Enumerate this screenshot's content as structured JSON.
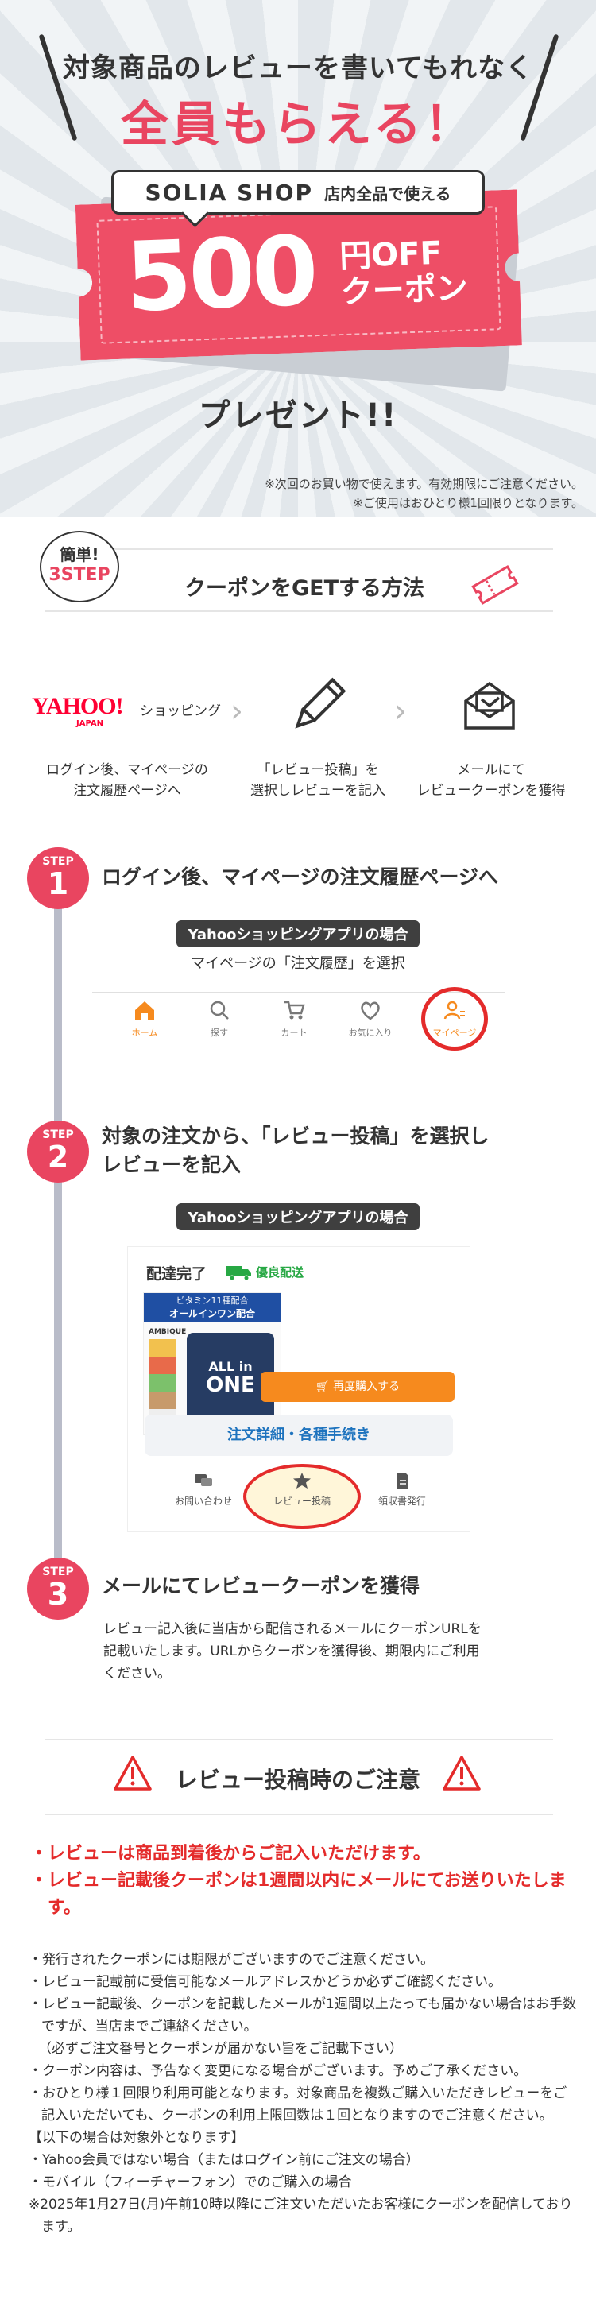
{
  "hero": {
    "line1": "対象商品のレビューを書いてもれなく",
    "line2": "全員もらえる！",
    "shop_logo": "SOLIA SHOP",
    "shop_subtitle": "店内全品で使える",
    "coupon_amount": "500",
    "coupon_unit_off": "円OFF",
    "coupon_type": "クーポン",
    "present": "プレゼント!!",
    "note1": "※次回のお買い物で使えます。有効期限にご注意ください。",
    "note2": "※ご使用はおひとり様1回限りとなります。"
  },
  "howto": {
    "badge_line1": "簡単!",
    "badge_line2": "3STEP",
    "title": "クーポンをGETする方法",
    "yahoo_logo": "YAHOO!",
    "yahoo_japan": "JAPAN",
    "yahoo_shopping": "ショッピング",
    "flow": [
      {
        "label1": "ログイン後、マイページの",
        "label2": "注文履歴ページへ"
      },
      {
        "label1": "「レビュー投稿」を",
        "label2": "選択しレビューを記入"
      },
      {
        "label1": "メールにて",
        "label2": "レビュークーポンを獲得"
      }
    ]
  },
  "steps": [
    {
      "word": "STEP",
      "num": "1",
      "title": "ログイン後、マイページの注文履歴ページへ",
      "app_label": "Yahooショッピングアプリの場合",
      "sub": "マイページの「注文履歴」を選択",
      "nav": [
        "ホーム",
        "探す",
        "カート",
        "お気に入り",
        "マイページ"
      ]
    },
    {
      "word": "STEP",
      "num": "2",
      "title_line1": "対象の注文から、「レビュー投稿」を選択し",
      "title_line2": "レビューを記入",
      "app_label": "Yahooショッピングアプリの場合",
      "delivered": "配達完了",
      "yuryo": "優良配送",
      "product_banner1": "ビタミン11種配合",
      "product_banner2": "オールインワン配合",
      "product_brand": "AMBIQUE",
      "product_name1": "ALL in",
      "product_name2": "ONE",
      "rebuy": "再度購入する",
      "detail": "注文詳細・各種手続き",
      "actions": [
        "お問い合わせ",
        "レビュー投稿",
        "領収書発行"
      ]
    },
    {
      "word": "STEP",
      "num": "3",
      "title": "メールにてレビュークーポンを獲得",
      "body1": "レビュー記入後に当店から配信されるメールにクーポンURLを",
      "body2": "記載いたします。URLからクーポンを獲得後、期限内にご利用",
      "body3": "ください。"
    }
  ],
  "notice": {
    "title": "レビュー投稿時のご注意",
    "red1": "・レビューは商品到着後からご記入いただけます。",
    "red2": "・レビュー記載後クーポンは1週間以内にメールにてお送りいたします。",
    "lines": [
      "・発行されたクーポンには期限がございますのでご注意ください。",
      "・レビュー記載前に受信可能なメールアドレスかどうか必ずご確認ください。",
      "・レビュー記載後、クーポンを記載したメールが1週間以上たっても届かない場合はお手数ですが、当店までご連絡ください。",
      "（必ずご注文番号とクーポンが届かない旨をご記載下さい）",
      "・クーポン内容は、予告なく変更になる場合がございます。予めご了承ください。",
      "・おひとり様１回限り利用可能となります。対象商品を複数ご購入いただきレビューをご記入いただいても、クーポンの利用上限回数は１回となりますのでご注意ください。",
      "【以下の場合は対象外となります】",
      "・Yahoo会員ではない場合（またはログイン前にご注文の場合）",
      "・モバイル（フィーチャーフォン）でのご購入の場合",
      "※2025年1月27日(月)午前10時以降にご注文いただいたお客様にクーポンを配信しております。"
    ]
  },
  "colors": {
    "accent": "#e94560",
    "warn": "#e42b2b",
    "orange": "#f68a1e",
    "green": "#27a844"
  }
}
